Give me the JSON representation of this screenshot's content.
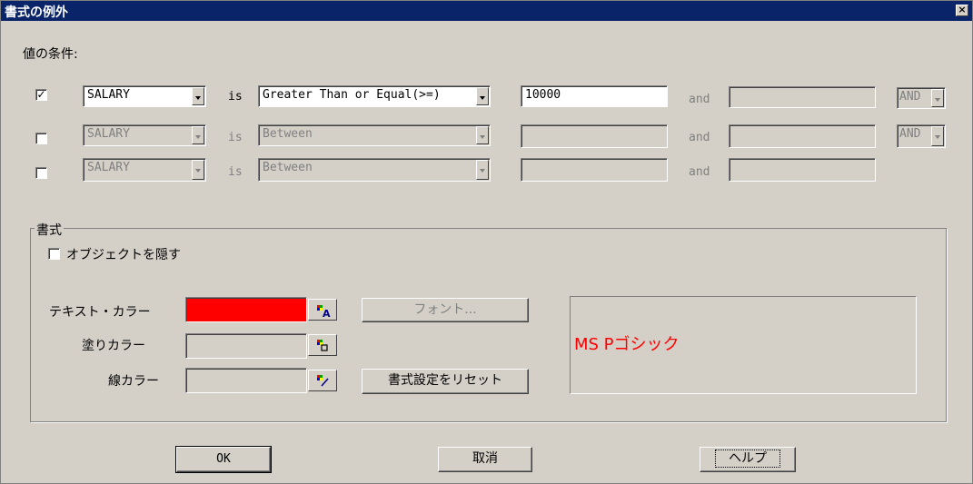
{
  "window": {
    "title": "書式の例外",
    "close": "×"
  },
  "conditions": {
    "heading": "値の条件:",
    "rows": [
      {
        "checked": "✓",
        "field": "SALARY",
        "is": "is",
        "op": "Greater Than or Equal(>=)",
        "value": "10000",
        "and": "and",
        "value2": "",
        "logic": "AND"
      },
      {
        "checked": "",
        "field": "SALARY",
        "is": "is",
        "op": "Between",
        "value": "",
        "and": "and",
        "value2": "",
        "logic": "AND"
      },
      {
        "checked": "",
        "field": "SALARY",
        "is": "is",
        "op": "Between",
        "value": "",
        "and": "and",
        "value2": ""
      }
    ]
  },
  "format": {
    "legend": "書式",
    "hide_object": "オブジェクトを隠す",
    "text_color_label": "テキスト・カラー",
    "fill_color_label": "塗りカラー",
    "line_color_label": "線カラー",
    "text_color": "#ff0000",
    "font_button": "フォント...",
    "reset_button": "書式設定をリセット",
    "preview_text": "MS Pゴシック"
  },
  "buttons": {
    "ok": "OK",
    "cancel": "取消",
    "help": "ヘルプ"
  }
}
